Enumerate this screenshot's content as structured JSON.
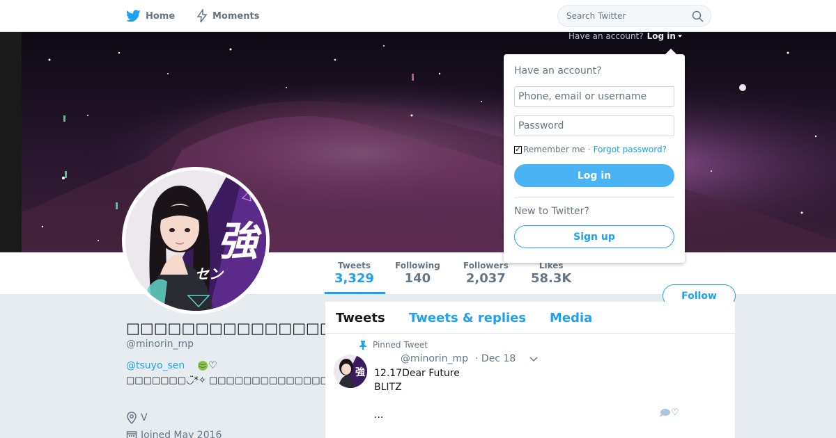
{
  "nav": {
    "home_label": "Home",
    "moments_label": "Moments",
    "search_placeholder": "Search Twitter"
  },
  "account_prompt": {
    "question": "Have an account?",
    "login_link": "Log in"
  },
  "login_dropdown": {
    "title": "Have an account?",
    "username_placeholder": "Phone, email or username",
    "password_placeholder": "Password",
    "remember_label": "Remember me",
    "separator": "·",
    "forgot_label": "Forgot password?",
    "login_button": "Log in",
    "new_prompt": "New to Twitter?",
    "signup_button": "Sign up"
  },
  "stats": [
    {
      "label": "Tweets",
      "value": "3,329"
    },
    {
      "label": "Following",
      "value": "140"
    },
    {
      "label": "Followers",
      "value": "2,037"
    },
    {
      "label": "Likes",
      "value": "58.3K"
    }
  ],
  "follow_button": "Follow",
  "profile": {
    "display_name": "□□□□□□□□□□□□□□□□□",
    "handle": "@minorin_mp",
    "bio_mention": "@tsuyo_sen",
    "bio_heart": "♡",
    "bio_line": "□□□□□□□◡̈*✧ □□□□□□□□□□□□□□□□□□□□",
    "location": "V",
    "joined": "Joined May 2016"
  },
  "avatar_art_text": {
    "big": "強",
    "small": "セン"
  },
  "timeline": {
    "tabs": [
      "Tweets",
      "Tweets & replies",
      "Media"
    ],
    "pinned_label": "Pinned Tweet",
    "tweet": {
      "handle": "@minorin_mp",
      "date": "· Dec 18",
      "line1": "12.17Dear Future",
      "line2": "BLITZ",
      "line3": "...",
      "like_symbol": "♡"
    }
  },
  "colors": {
    "accent": "#1da1f2",
    "login_button": "#4ab3f4"
  }
}
